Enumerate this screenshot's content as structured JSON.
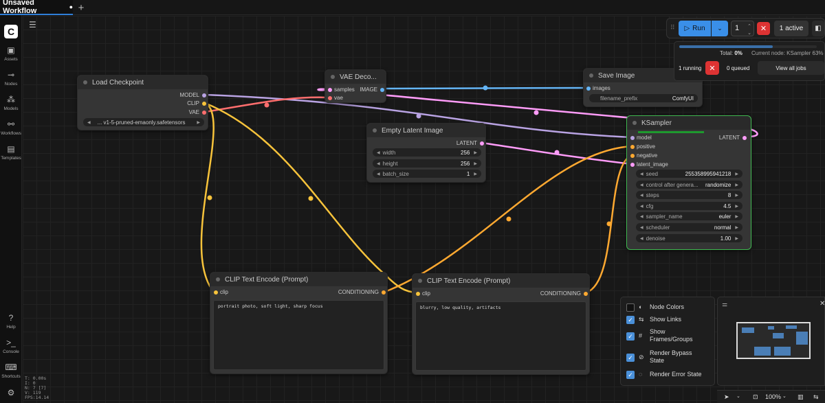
{
  "tab": {
    "title": "Unsaved Workflow",
    "modified_dot": "●",
    "new_tab": "+"
  },
  "sidebar": {
    "items": [
      {
        "label": "Assets",
        "icon": "image-icon"
      },
      {
        "label": "Nodes",
        "icon": "nodes-icon"
      },
      {
        "label": "Models",
        "icon": "models-icon"
      },
      {
        "label": "Workflows",
        "icon": "workflows-icon"
      },
      {
        "label": "Templates",
        "icon": "templates-icon"
      },
      {
        "label": "Help",
        "icon": "help-icon"
      },
      {
        "label": "Console",
        "icon": "console-icon"
      },
      {
        "label": "Shortcuts",
        "icon": "keyboard-icon"
      }
    ],
    "stats": [
      "T: 0.00s",
      "I: 0",
      "N: 7 [7]",
      "V: 119",
      "FPS:14.14"
    ]
  },
  "toolbar": {
    "run_label": "Run",
    "batch_count": "1",
    "active_label": "1 active"
  },
  "queue": {
    "progress": 0.68,
    "total_label": "Total:",
    "total_value": "0%",
    "current_node": "Current node: KSampler 63%",
    "running": "1 running",
    "queued": "0 queued",
    "view_all": "View all jobs"
  },
  "nodes": {
    "load_checkpoint": {
      "title": "Load Checkpoint",
      "outputs": [
        "MODEL",
        "CLIP",
        "VAE"
      ],
      "ckpt_name": "... v1-5-pruned-emaonly.safetensors"
    },
    "vae_decode": {
      "title": "VAE Deco...",
      "inputs": [
        "samples",
        "vae"
      ],
      "output": "IMAGE"
    },
    "save_image": {
      "title": "Save Image",
      "input": "images",
      "prefix_label": "filename_prefix",
      "prefix_value": "ComfyUI"
    },
    "empty_latent": {
      "title": "Empty Latent Image",
      "output": "LATENT",
      "widgets": [
        {
          "label": "width",
          "value": "256"
        },
        {
          "label": "height",
          "value": "256"
        },
        {
          "label": "batch_size",
          "value": "1"
        }
      ]
    },
    "ksampler": {
      "title": "KSampler",
      "inputs": [
        "model",
        "positive",
        "negative",
        "latent_image"
      ],
      "output": "LATENT",
      "widgets": [
        {
          "label": "seed",
          "value": "255358995941218"
        },
        {
          "label": "control after genera...",
          "value": "randomize"
        },
        {
          "label": "steps",
          "value": "8"
        },
        {
          "label": "cfg",
          "value": "4.5"
        },
        {
          "label": "sampler_name",
          "value": "euler"
        },
        {
          "label": "scheduler",
          "value": "normal"
        },
        {
          "label": "denoise",
          "value": "1.00"
        }
      ]
    },
    "clip_pos": {
      "title": "CLIP Text Encode (Prompt)",
      "input": "clip",
      "output": "CONDITIONING",
      "text": "portrait photo, soft light, sharp focus"
    },
    "clip_neg": {
      "title": "CLIP Text Encode (Prompt)",
      "input": "clip",
      "output": "CONDITIONING",
      "text": "blurry, low quality, artifacts"
    }
  },
  "settings": {
    "options": [
      {
        "label": "Node Colors",
        "checked": false
      },
      {
        "label": "Show Links",
        "checked": true
      },
      {
        "label": "Show Frames/Groups",
        "checked": true
      },
      {
        "label": "Render Bypass State",
        "checked": true
      },
      {
        "label": "Render Error State",
        "checked": true
      }
    ]
  },
  "bottombar": {
    "zoom": "100%"
  },
  "colors": {
    "accent": "#3a8fe8",
    "model_link": "#b9a3e3",
    "clip_link": "#f7c33b",
    "vae_link": "#ff6e6e",
    "latent_link": "#ff9cf9",
    "image_link": "#64b5f6",
    "conditioning_link": "#ffa931",
    "selected_outline": "#3fb950"
  }
}
